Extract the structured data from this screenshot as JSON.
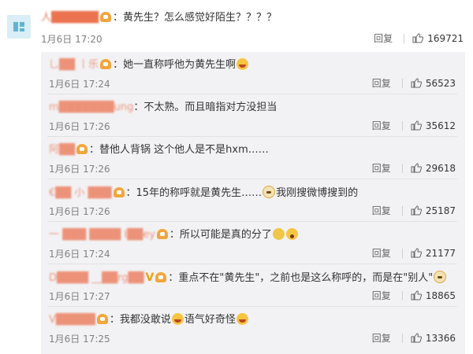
{
  "main": {
    "username": "人██████",
    "text": "：黄先生？怎么感觉好陌生？？？？",
    "time": "1月6日 17:20",
    "reply_label": "回复",
    "likes": "169721"
  },
  "replies": [
    {
      "username": "乚██ 丨乐",
      "text": "：她一直称呼他为黄先生啊",
      "time": "1月6日 17:24",
      "reply_label": "回复",
      "likes": "56523",
      "emoji": "laugh",
      "badge": true
    },
    {
      "username": "m███████ung",
      "text": "：不太熟。而且暗指对方没担当",
      "time": "1月6日 17:26",
      "reply_label": "回复",
      "likes": "35612",
      "emoji": "",
      "badge": false
    },
    {
      "username": "阿██",
      "text": "：替他人背锅 这个他人是不是hxm……",
      "time": "1月6日 17:26",
      "reply_label": "回复",
      "likes": "29618",
      "emoji": "",
      "badge": true
    },
    {
      "username": "€██ 小 ███",
      "text": "：15年的称呼就是黄先生……",
      "text2": "我刚搜微博搜到的",
      "time": "1月6日 17:26",
      "reply_label": "回复",
      "likes": "25187",
      "emoji": "dog",
      "badge": true
    },
    {
      "username": "一 ███ ████ I██ey",
      "text": "：所以可能是真的分了",
      "time": "1月6日 17:24",
      "reply_label": "回复",
      "likes": "21177",
      "emoji": "shrug",
      "badge": true
    },
    {
      "username": "D████ __██rg██",
      "text": "：重点不在\"黄先生\"，之前也是这么称呼的，而是在\"别人\"",
      "time": "1月6日 17:27",
      "reply_label": "回复",
      "likes": "18865",
      "emoji": "dog",
      "badge": true,
      "verified": "V"
    },
    {
      "username": "V█████",
      "text": "：我都没敢说",
      "text2": "语气好奇怪",
      "time": "1月6日 17:25",
      "reply_label": "回复",
      "likes": "13366",
      "emoji": "laugh",
      "badge": true
    }
  ]
}
